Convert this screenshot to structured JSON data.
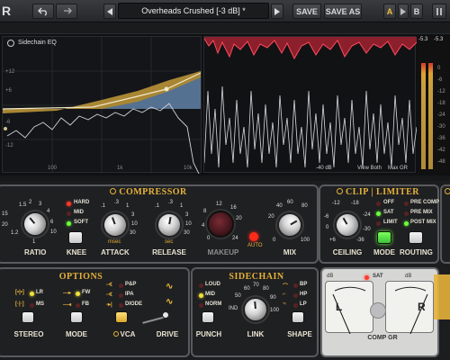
{
  "topbar": {
    "logo": "R",
    "undo_icon": "undo-icon",
    "redo_icon": "redo-icon",
    "preset_name": "Overheads Crushed [-3 dB] *",
    "prev_icon": "prev-icon",
    "next_icon": "next-icon",
    "save": "SAVE",
    "save_as": "SAVE AS",
    "a": "A",
    "b": "B"
  },
  "display": {
    "eq_title": "Sidechain EQ",
    "eq_db_labels": [
      "+12",
      "+6",
      "-6",
      "-12"
    ],
    "eq_freq_labels": [
      "100",
      "1k",
      "10k"
    ],
    "wave_labels": {
      "db": "-40 dB",
      "view": "View Both",
      "max": "Max GR"
    },
    "meter_top": [
      "-5.3",
      "-5.3"
    ],
    "meter_scale": [
      "0",
      "-6",
      "-12",
      "-18",
      "-24",
      "-30",
      "-36",
      "-42",
      "-48"
    ]
  },
  "compressor": {
    "title": "COMPRESSOR",
    "ratio": {
      "label": "RATIO",
      "ticks": [
        "1.5",
        "2",
        "3",
        "4",
        "6",
        "10",
        "15",
        "20",
        "1.2",
        "1"
      ]
    },
    "knee_modes": [
      "HARD",
      "MID",
      "SOFT"
    ],
    "knee_label": "KNEE",
    "attack": {
      "label": "ATTACK",
      "unit": "msec",
      "ticks": [
        ".1",
        ".3",
        "1",
        "3",
        "10",
        "30"
      ]
    },
    "release": {
      "label": "RELEASE",
      "unit": "sec",
      "ticks": [
        ".1",
        ".3",
        "1",
        "3",
        "10",
        "30"
      ]
    },
    "makeup": {
      "label": "MAKEUP",
      "ticks": [
        "12",
        "16",
        "20",
        "24",
        "8",
        "4",
        "0"
      ],
      "auto": "AUTO"
    },
    "mix": {
      "label": "MIX",
      "ticks": [
        "40",
        "60",
        "80",
        "20",
        "0",
        "100"
      ]
    }
  },
  "clip_limiter": {
    "title": "CLIP | LIMITER",
    "ceiling": {
      "label": "CEILING",
      "ticks": [
        "-12",
        "-18",
        "-6",
        "-24",
        "0",
        "-30",
        "+6",
        "-36"
      ]
    },
    "modes": [
      "OFF",
      "SAT",
      "LIMIT"
    ],
    "mode_label": "MODE",
    "routes": [
      "PRE COMP",
      "PRE MIX",
      "POST MIX"
    ],
    "routing_label": "ROUTING"
  },
  "options": {
    "title": "OPTIONS",
    "stereo_modes": [
      "LR",
      "MS"
    ],
    "stereo_label": "STEREO",
    "mode_modes": [
      "FW",
      "FB"
    ],
    "mode_label": "MODE",
    "vca_modes": [
      "P&P",
      "IPA",
      "DIODE"
    ],
    "vca_label": "VCA",
    "drive_label": "DRIVE"
  },
  "sidechain": {
    "title": "SIDECHAIN",
    "punch_modes": [
      "LOUD",
      "MID",
      "NORM"
    ],
    "punch_label": "PUNCH",
    "link_ticks": [
      "60",
      "70",
      "80",
      "50",
      "90",
      "IND",
      "100"
    ],
    "link_label": "LINK",
    "shape_modes": [
      "BP",
      "HP",
      "LP"
    ],
    "shape_label": "SHAPE"
  },
  "vu": {
    "sat_label": "SAT",
    "left": "L",
    "right": "R",
    "comp_gr": "COMP GR",
    "db_label": "dB"
  },
  "colors": {
    "accent": "#e6b23a",
    "led_green": "#6bff3a",
    "led_red": "#ff3a2a",
    "gr_curve": "#d02a3a"
  }
}
